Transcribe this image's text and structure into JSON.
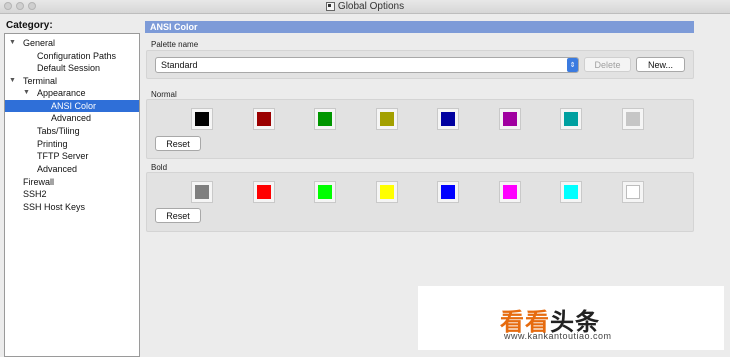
{
  "window": {
    "title": "Global Options"
  },
  "category": {
    "label": "Category:",
    "items": [
      {
        "label": "General",
        "expanded": true
      },
      {
        "label": "Configuration Paths"
      },
      {
        "label": "Default Session"
      },
      {
        "label": "Terminal",
        "expanded": true
      },
      {
        "label": "Appearance",
        "expanded": true
      },
      {
        "label": "ANSI Color",
        "selected": true
      },
      {
        "label": "Advanced"
      },
      {
        "label": "Tabs/Tiling"
      },
      {
        "label": "Printing"
      },
      {
        "label": "TFTP Server"
      },
      {
        "label": "Advanced"
      },
      {
        "label": "Firewall"
      },
      {
        "label": "SSH2"
      },
      {
        "label": "SSH Host Keys"
      }
    ]
  },
  "panel": {
    "title": "ANSI Color",
    "palette_label": "Palette name",
    "palette_value": "Standard",
    "delete_label": "Delete",
    "new_label": "New...",
    "normal": {
      "label": "Normal",
      "reset_label": "Reset",
      "colors": [
        "#000000",
        "#9b0000",
        "#009600",
        "#a3a000",
        "#0000a0",
        "#a000a0",
        "#00a0a0",
        "#c6c6c6"
      ]
    },
    "bold": {
      "label": "Bold",
      "reset_label": "Reset",
      "colors": [
        "#7f7f7f",
        "#ff0000",
        "#00ff00",
        "#ffff00",
        "#0000ff",
        "#ff00ff",
        "#00ffff",
        "#ffffff"
      ]
    }
  },
  "watermark": {
    "logo_part1": "看看",
    "logo_part2": "头条",
    "url": "www.kankantoutiao.com"
  }
}
